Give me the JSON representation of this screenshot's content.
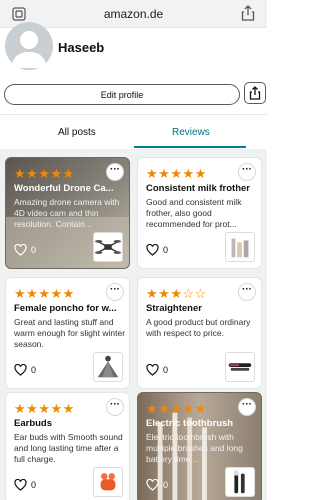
{
  "browser": {
    "url": "amazon.de"
  },
  "profile": {
    "name": "Haseeb",
    "edit_label": "Edit profile"
  },
  "tabs": [
    {
      "label": "All posts",
      "active": false
    },
    {
      "label": "Reviews",
      "active": true
    }
  ],
  "reviews": [
    {
      "rating": 5,
      "title": "Wonderful Drone Ca...",
      "body": "Amazing drone camera with 4D video cam and thin resolution. Contain...",
      "likes": "0",
      "product_icon": "drone-icon"
    },
    {
      "rating": 5,
      "title": "Consistent milk frother",
      "body": "Good and consistent milk frother, also good recommended for prot...",
      "likes": "0",
      "product_icon": "milk-frother-icon"
    },
    {
      "rating": 5,
      "title": "Female poncho for w...",
      "body": "Great and lasting stuff and warm enough for slight winter season.",
      "likes": "0",
      "product_icon": "poncho-icon"
    },
    {
      "rating": 3,
      "title": "Straightener",
      "body": "A good product but ordinary with respect to price.",
      "likes": "0",
      "product_icon": "hair-straightener-icon"
    },
    {
      "rating": 5,
      "title": "Earbuds",
      "body": "Ear buds with Smooth sound and long lasting time after a full charge.",
      "likes": "0",
      "product_icon": "earbuds-icon"
    },
    {
      "rating": 5,
      "title": "Electric toothbrush",
      "body": "Electric toothbrush with multiple brushes and long battery time...",
      "likes": "0",
      "product_icon": "toothbrush-icon"
    }
  ],
  "colors": {
    "star": "#f08804",
    "tab_active": "#007185",
    "tab_underline": "#008296"
  }
}
